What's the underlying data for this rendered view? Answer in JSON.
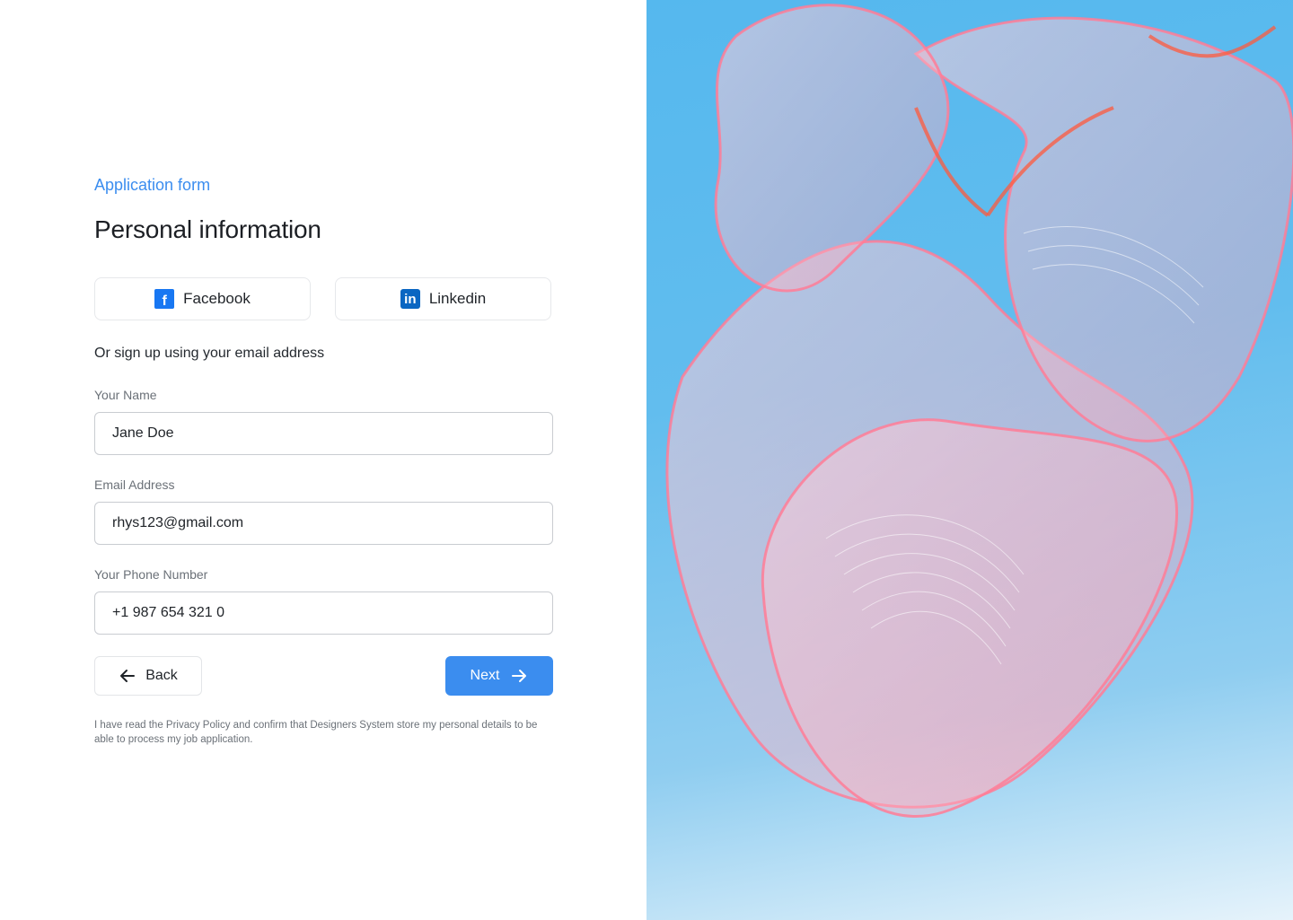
{
  "form": {
    "eyebrow": "Application form",
    "title": "Personal information",
    "social": [
      {
        "label": "Facebook",
        "icon": "facebook-icon",
        "color": "#1877f2"
      },
      {
        "label": "Linkedin",
        "icon": "linkedin-icon",
        "color": "#0a66c2"
      }
    ],
    "alt_text": "Or sign up using your email address",
    "fields": {
      "name": {
        "label": "Your Name",
        "value": "Jane Doe"
      },
      "email": {
        "label": "Email Address",
        "value": "rhys123@gmail.com"
      },
      "phone": {
        "label": "Your Phone Number",
        "value": "+1 987 654 321 0"
      }
    },
    "back_label": "Back",
    "next_label": "Next",
    "legal": "I have read the Privacy Policy and confirm that Designers System store my personal details to be able to process my job application."
  },
  "theme": {
    "accent": "#3b8def",
    "image_sky": "#5bb9ee",
    "image_ribbon": "#ff8aa0"
  }
}
